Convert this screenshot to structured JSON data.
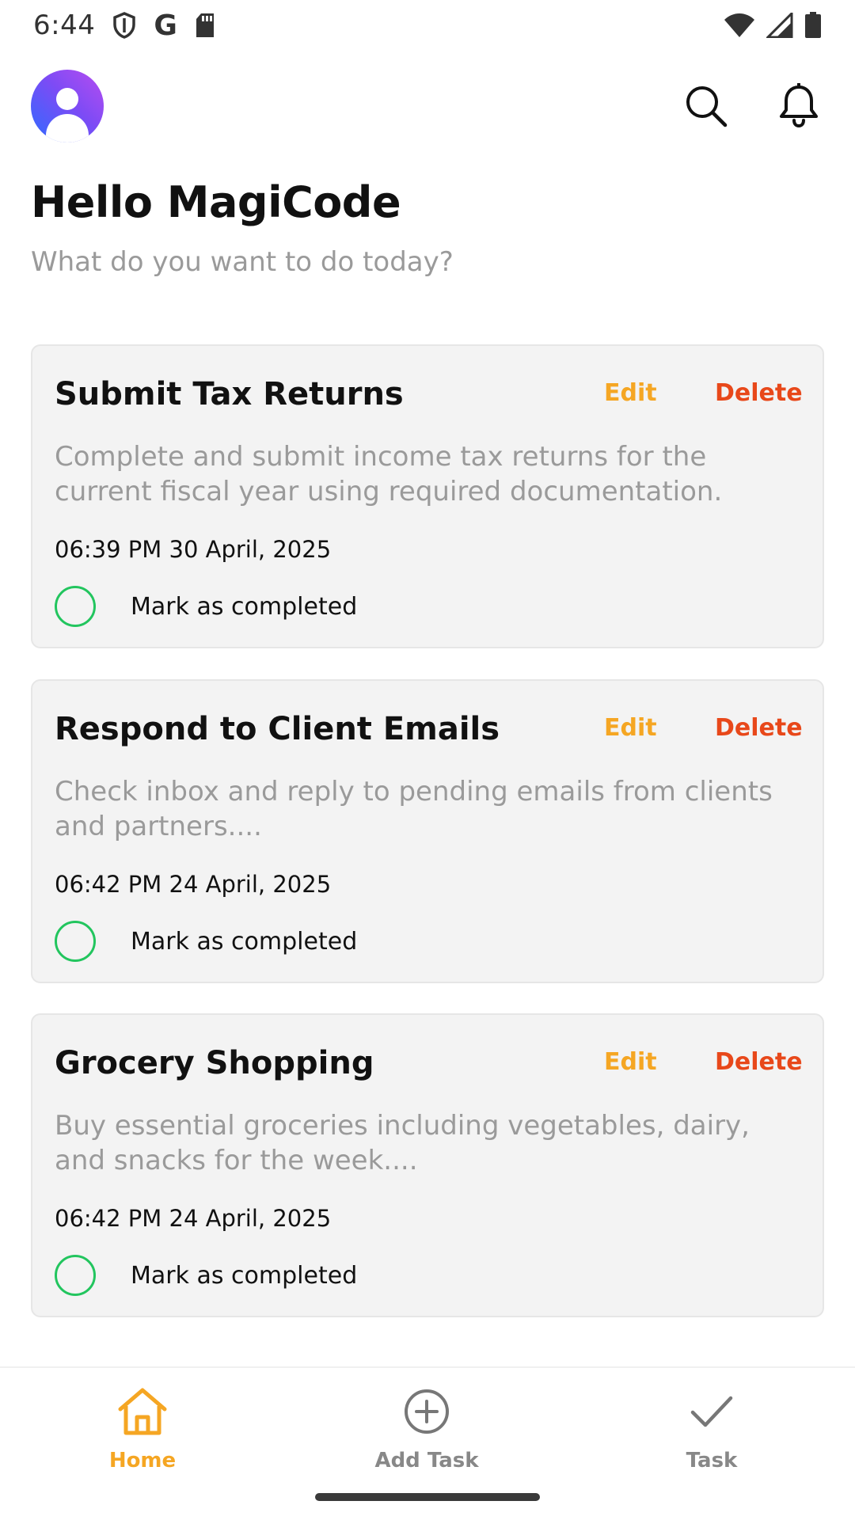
{
  "status_bar": {
    "time": "6:44",
    "left_icons": [
      "shield-icon",
      "google-icon",
      "sd-card-icon"
    ],
    "google_glyph": "G",
    "right_icons": [
      "wifi-icon",
      "cellular-signal-icon",
      "battery-icon"
    ]
  },
  "header": {
    "avatar_icon": "user-avatar-icon",
    "actions": [
      "search-icon",
      "bell-icon"
    ]
  },
  "greeting": {
    "title": "Hello MagiCode",
    "subtitle": "What do you want to do today?"
  },
  "tasks": [
    {
      "title": "Submit Tax Returns",
      "edit_label": "Edit",
      "delete_label": "Delete",
      "description": "Complete and submit income tax returns for the current fiscal year using required documentation.",
      "datetime": "06:39 PM 30 April, 2025",
      "complete_label": "Mark as completed"
    },
    {
      "title": "Respond to Client Emails",
      "edit_label": "Edit",
      "delete_label": "Delete",
      "description": "Check inbox and reply to pending emails from clients and partners....",
      "datetime": "06:42 PM 24 April, 2025",
      "complete_label": "Mark as completed"
    },
    {
      "title": "Grocery Shopping",
      "edit_label": "Edit",
      "delete_label": "Delete",
      "description": "Buy essential groceries including vegetables, dairy, and snacks for the week....",
      "datetime": "06:42 PM 24 April, 2025",
      "complete_label": "Mark as completed"
    }
  ],
  "bottom_nav": {
    "items": [
      {
        "label": "Home",
        "icon": "home-icon",
        "active": true
      },
      {
        "label": "Add Task",
        "icon": "add-circle-icon",
        "active": false
      },
      {
        "label": "Task",
        "icon": "check-icon",
        "active": false
      }
    ]
  },
  "colors": {
    "accent": "#f5a623",
    "delete": "#e8481a",
    "complete_ring": "#22c55e",
    "card_bg": "#f3f3f3",
    "muted_text": "#9a9a9a"
  }
}
